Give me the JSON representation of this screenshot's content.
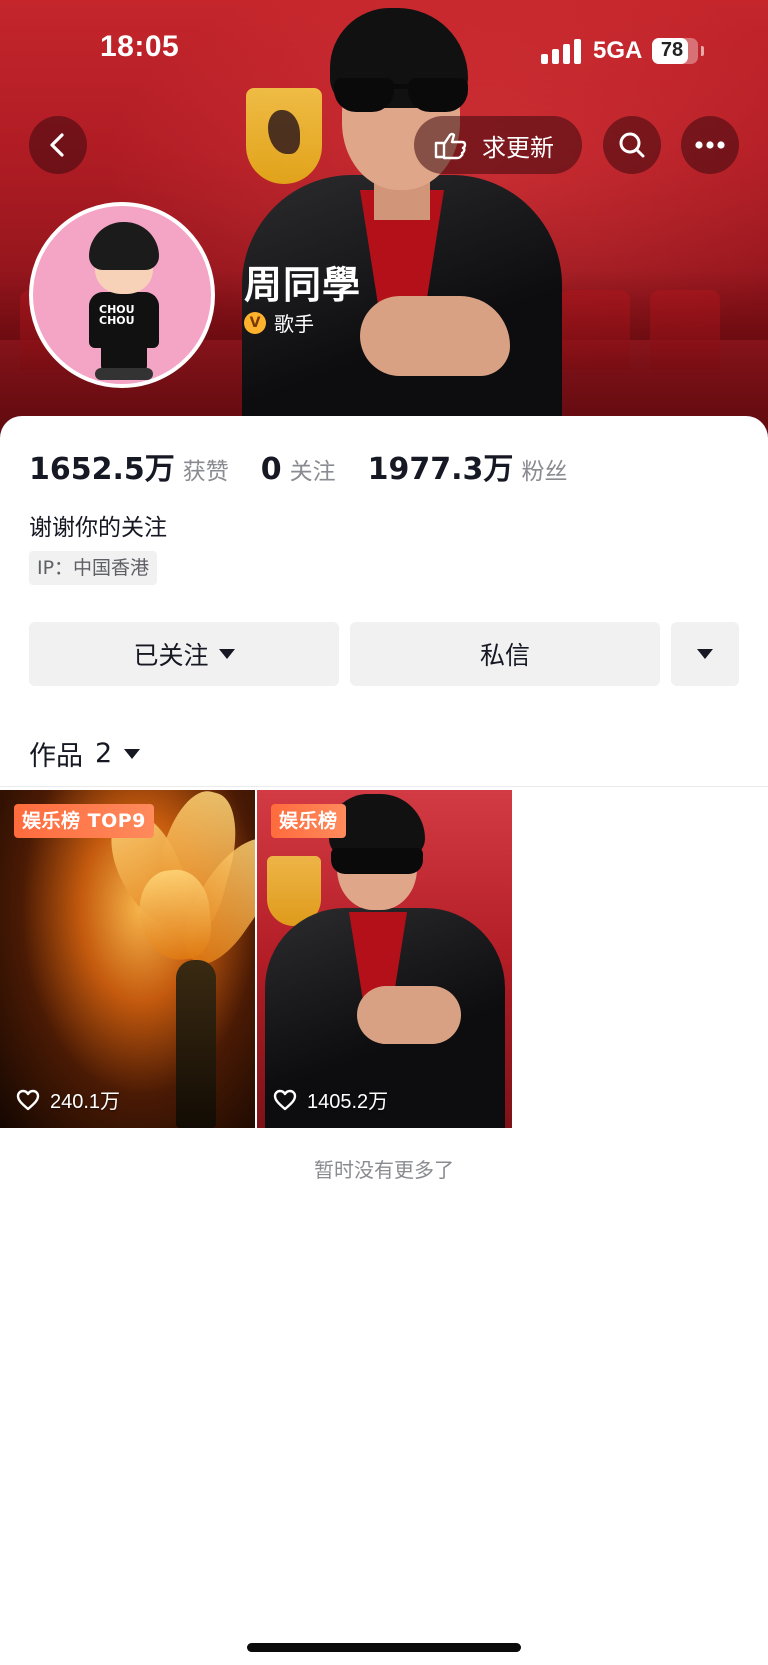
{
  "status_bar": {
    "time": "18:05",
    "network": "5GA",
    "battery": "78",
    "battery_level": 0.78
  },
  "top_nav": {
    "request_update_label": "求更新",
    "icons": [
      "back-icon",
      "hand-pointing-icon",
      "search-icon",
      "more-icon"
    ]
  },
  "profile": {
    "name": "周同學",
    "verified_badge": "V",
    "verified_title": "歌手",
    "avatar_shirt_text": "CHOU CHOU"
  },
  "stats": [
    {
      "value": "1652.5万",
      "label": "获赞"
    },
    {
      "value": "0",
      "label": "关注"
    },
    {
      "value": "1977.3万",
      "label": "粉丝"
    }
  ],
  "bio": "谢谢你的关注",
  "ip_location": "IP：中国香港",
  "actions": {
    "follow_label": "已关注",
    "message_label": "私信"
  },
  "works_tab": {
    "label": "作品",
    "count": "2"
  },
  "works": [
    {
      "badge": "娱乐榜 TOP9",
      "likes": "240.1万"
    },
    {
      "badge": "娱乐榜",
      "likes": "1405.2万"
    }
  ],
  "footer_text": "暂时没有更多了",
  "colors": {
    "header_red": "#b01c24",
    "badge_orange": "#ff6b3d",
    "verify_gold": "#ffb22e",
    "button_gray": "#f1f1f2"
  }
}
